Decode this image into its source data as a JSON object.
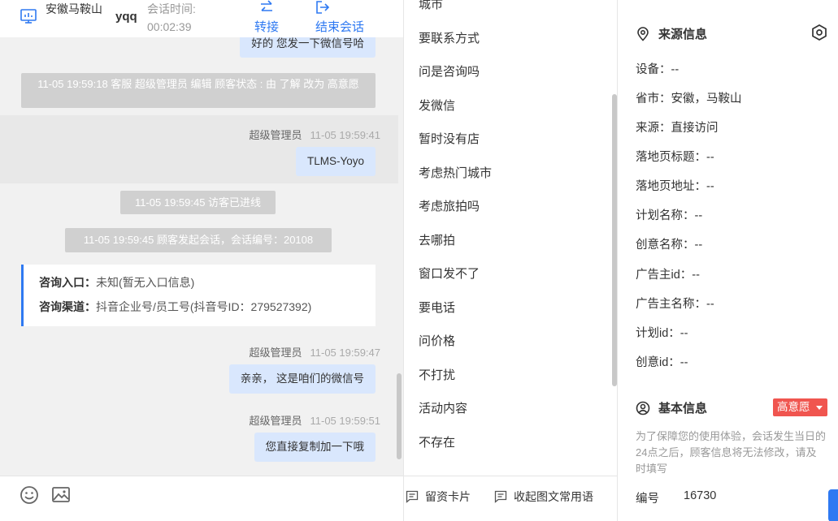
{
  "header": {
    "location": "安徽马鞍山",
    "user": "yqq",
    "time_label": "会话时间:",
    "time_value": "00:02:39",
    "transfer_label": "转接",
    "end_label": "结束会话"
  },
  "chat": {
    "top_bubble": "好的 您发一下微信号哈",
    "system_1": "11-05 19:59:18 客服 超级管理员 编辑 顾客状态 : 由 了解 改为 高意愿",
    "msg_1": {
      "sender": "超级管理员",
      "time": "11-05 19:59:41",
      "text": "TLMS-Yoyo"
    },
    "system_2": "11-05 19:59:45 访客已进线",
    "system_3": "11-05 19:59:45 顾客发起会话，会话编号：20108",
    "info_card": {
      "entry_key": "咨询入口：",
      "entry_val": "未知(暂无入口信息)",
      "channel_key": "咨询渠道：",
      "channel_val": "抖音企业号/员工号(抖音号ID：279527392)"
    },
    "msg_2": {
      "sender": "超级管理员",
      "time": "11-05 19:59:47",
      "text": "亲亲， 这是咱们的微信号"
    },
    "msg_3": {
      "sender": "超级管理员",
      "time": "11-05 19:59:51",
      "text": "您直接复制加一下哦"
    }
  },
  "footer": {
    "emoji_icon": "smile-icon",
    "image_icon": "image-icon"
  },
  "quick_replies": {
    "items": [
      "城市",
      "要联系方式",
      "问是咨询吗",
      "发微信",
      "暂时没有店",
      "考虑热门城市",
      "考虑旅拍吗",
      "去哪拍",
      "窗口发不了",
      "要电话",
      "问价格",
      "不打扰",
      "活动内容",
      "不存在"
    ],
    "card_label": "留资卡片",
    "collapse_label": "收起图文常用语"
  },
  "panel": {
    "source_title": "来源信息",
    "source_rows": [
      "设备：--",
      "省市：安徽，马鞍山",
      "来源：直接访问",
      "落地页标题：--",
      "落地页地址：--",
      "计划名称：--",
      "创意名称：--",
      "广告主id：--",
      "广告主名称：--",
      "计划id：--",
      "创意id：--"
    ],
    "basic_title": "基本信息",
    "intent_badge": "高意愿",
    "note": "为了保障您的使用体验，会话发生当日的24点之后，顾客信息将无法修改，请及时填写",
    "number_label": "编号",
    "number_value": "16730"
  },
  "colors": {
    "accent": "#2e79f2",
    "bubble": "#d9e7fd",
    "badge": "#f0554f",
    "system": "#d0d0d0"
  }
}
